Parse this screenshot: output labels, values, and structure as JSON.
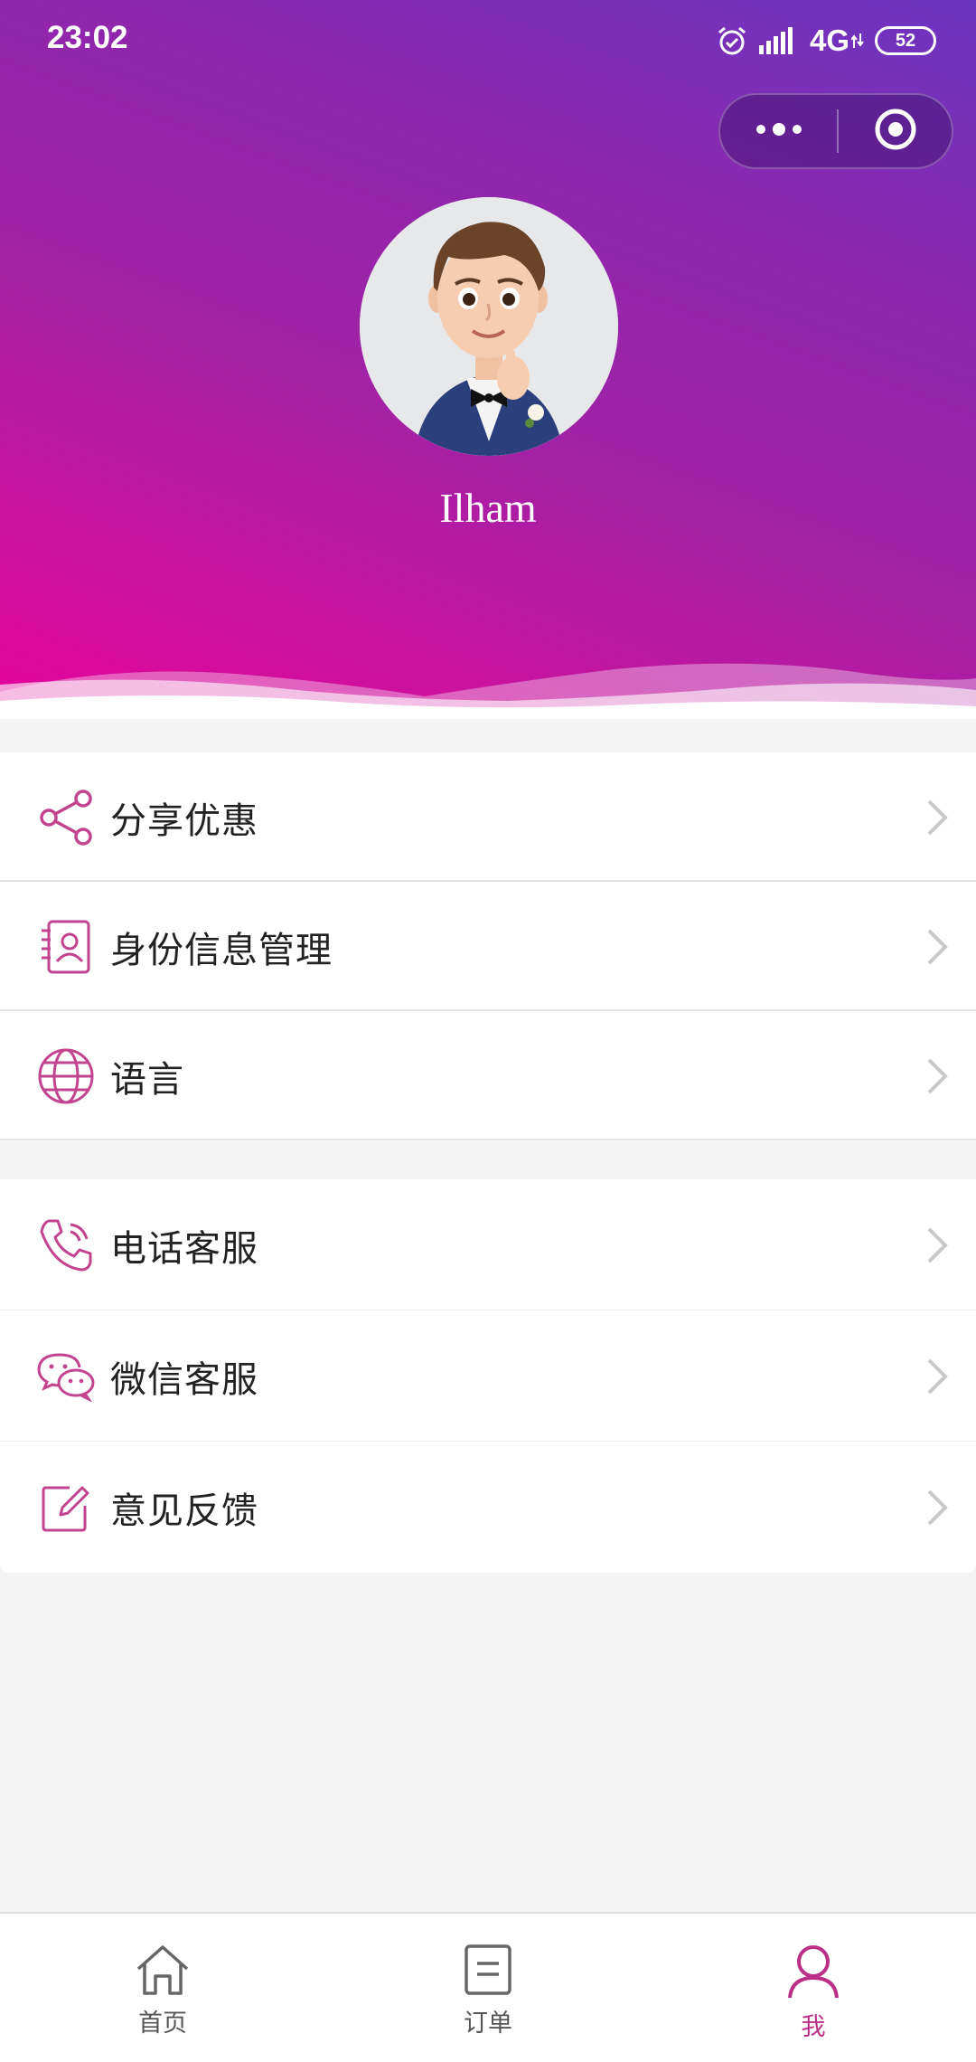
{
  "status_bar": {
    "time": "23:02",
    "network": "4G",
    "battery": "52",
    "icons": [
      "alarm-icon",
      "signal-icon",
      "network-arrows-icon",
      "battery-icon"
    ]
  },
  "capsule": {
    "more_icon": "more-dots-icon",
    "close_icon": "target-circle-icon"
  },
  "profile": {
    "name": "Ilham",
    "avatar": "cartoon-avatar-man-in-tuxedo"
  },
  "menu_groups": [
    {
      "items": [
        {
          "label": "分享优惠",
          "icon": "share-icon"
        },
        {
          "label": "身份信息管理",
          "icon": "id-card-icon"
        },
        {
          "label": "语言",
          "icon": "globe-icon"
        }
      ]
    },
    {
      "items": [
        {
          "label": "电话客服",
          "icon": "phone-icon"
        },
        {
          "label": "微信客服",
          "icon": "wechat-icon"
        },
        {
          "label": "意见反馈",
          "icon": "edit-icon"
        }
      ]
    }
  ],
  "tabbar": {
    "tabs": [
      {
        "label": "首页",
        "icon": "home-icon",
        "active": false
      },
      {
        "label": "订单",
        "icon": "order-icon",
        "active": false
      },
      {
        "label": "我",
        "icon": "user-icon",
        "active": true
      }
    ]
  },
  "colors": {
    "accent": "#bb2f86",
    "icon": "#c2448f",
    "header_gradient": [
      "#e6039a",
      "#a022a5",
      "#6a35c0"
    ],
    "background": "#f4f4f4"
  }
}
